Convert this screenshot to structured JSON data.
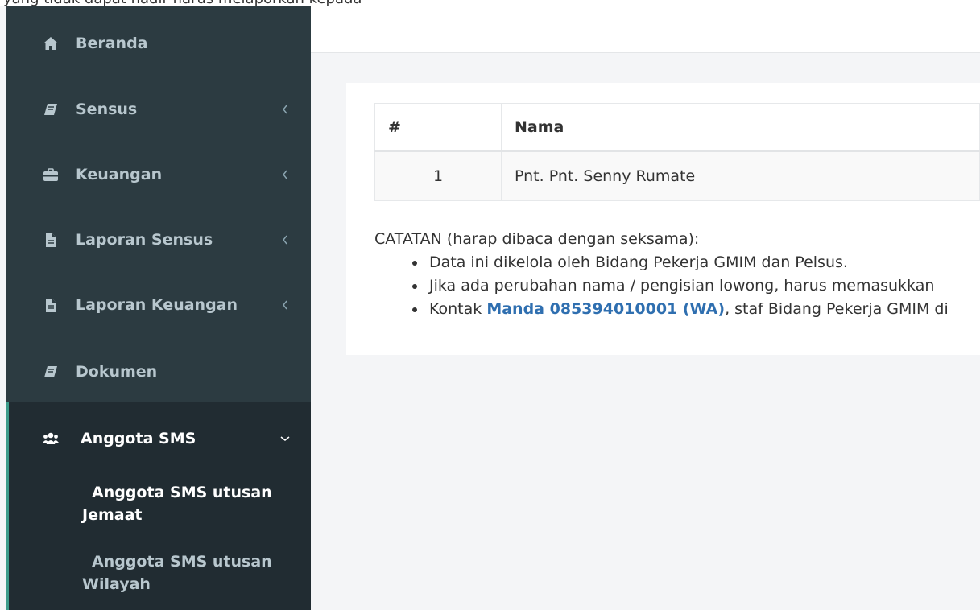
{
  "top_strip_text": "yang tidak dapat hadir harus melaporkan kepada",
  "sidebar": {
    "items": [
      {
        "label": "Beranda",
        "icon": "home-icon"
      },
      {
        "label": "Sensus",
        "icon": "book-icon"
      },
      {
        "label": "Keuangan",
        "icon": "briefcase-icon"
      },
      {
        "label": "Laporan Sensus",
        "icon": "file-icon"
      },
      {
        "label": "Laporan Keuangan",
        "icon": "file-icon"
      },
      {
        "label": "Dokumen",
        "icon": "book-icon"
      },
      {
        "label": "Anggota SMS",
        "icon": "users-icon"
      }
    ],
    "subitems": [
      {
        "label": "Anggota SMS utusan Jemaat"
      },
      {
        "label": "Anggota SMS utusan Wilayah"
      }
    ],
    "colors": {
      "bg": "#2c3b41",
      "active_bg": "#212c32",
      "text": "#b8c7ce"
    }
  },
  "table": {
    "headers": [
      "#",
      "Nama"
    ],
    "rows": [
      {
        "num": "1",
        "name": "Pnt. Pnt. Senny Rumate"
      }
    ]
  },
  "notes": {
    "title": "CATATAN (harap dibaca dengan seksama):",
    "item1": "Data ini dikelola oleh Bidang Pekerja GMIM dan Pelsus.",
    "item2": "Jika ada perubahan nama / pengisian lowong, harus memasukkan",
    "item3_prefix": "Kontak ",
    "item3_link": "Manda 085394010001 (WA)",
    "item3_suffix": ", staf Bidang Pekerja GMIM di"
  }
}
